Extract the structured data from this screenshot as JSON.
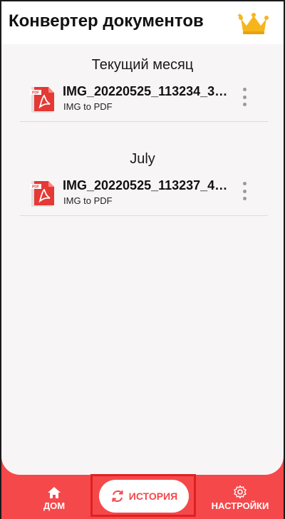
{
  "app_bar": {
    "title": "Конвертер документов",
    "premium_icon": "crown-icon"
  },
  "sections": [
    {
      "header": "Текущий месяц",
      "files": [
        {
          "name": "IMG_20220525_113234_37...",
          "type": "IMG to PDF",
          "icon": "pdf-file-icon"
        }
      ]
    },
    {
      "header": "July",
      "files": [
        {
          "name": "IMG_20220525_113237_48...",
          "type": "IMG to PDF",
          "icon": "pdf-file-icon"
        }
      ]
    }
  ],
  "bottom_nav": {
    "home": {
      "label": "ДОМ",
      "icon": "home-icon"
    },
    "history": {
      "label": "ИСТОРИЯ",
      "icon": "sync-icon",
      "selected": true
    },
    "settings": {
      "label": "НАСТРОЙКИ",
      "icon": "gear-icon"
    }
  },
  "colors": {
    "accent": "#f5484b",
    "content_bg": "#f8f5f6",
    "pdf_red": "#e53935",
    "crown_gold": "#f7b51c"
  }
}
